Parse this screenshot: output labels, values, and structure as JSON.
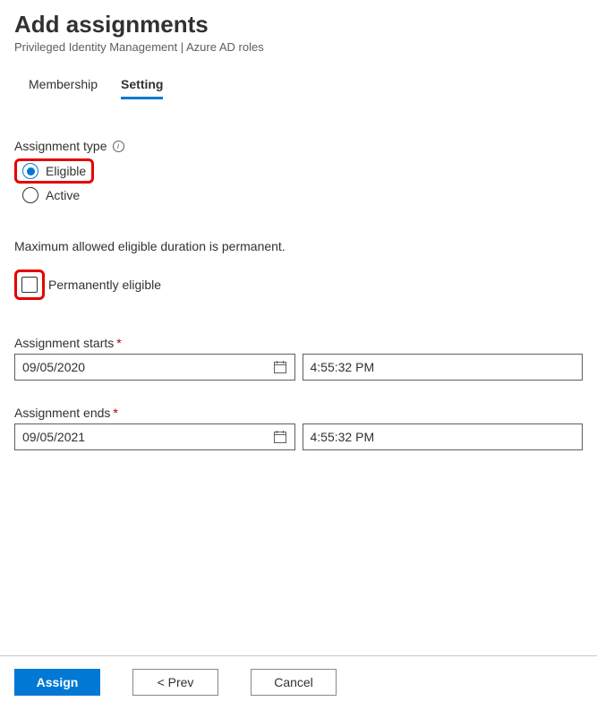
{
  "header": {
    "title": "Add assignments",
    "subtitle": "Privileged Identity Management | Azure AD roles"
  },
  "tabs": {
    "membership": "Membership",
    "setting": "Setting",
    "active": "setting"
  },
  "assignment_type": {
    "label": "Assignment type",
    "options": {
      "eligible": "Eligible",
      "active": "Active"
    },
    "selected": "eligible"
  },
  "duration_info": "Maximum allowed eligible duration is permanent.",
  "permanently_eligible": {
    "label": "Permanently eligible",
    "checked": false
  },
  "assignment_starts": {
    "label": "Assignment starts",
    "date": "09/05/2020",
    "time": "4:55:32 PM"
  },
  "assignment_ends": {
    "label": "Assignment ends",
    "date": "09/05/2021",
    "time": "4:55:32 PM"
  },
  "footer": {
    "assign": "Assign",
    "prev": "<  Prev",
    "cancel": "Cancel"
  }
}
